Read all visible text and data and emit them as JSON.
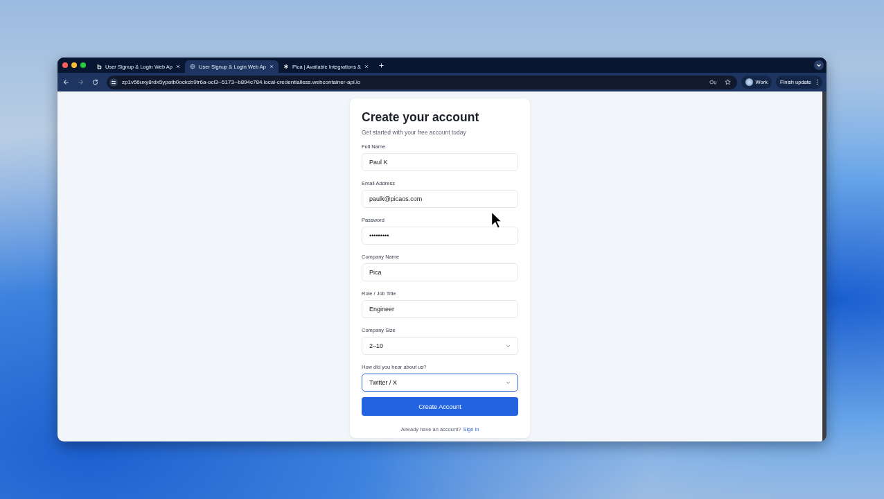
{
  "browser": {
    "tabs": [
      {
        "kind": "letter-logo",
        "title": "User Signup & Login Web Ap",
        "selected": false
      },
      {
        "kind": "globe",
        "title": "User Signup & Login Web Ap",
        "selected": true
      },
      {
        "kind": "asterisk",
        "title": "Pica | Available Integrations &",
        "selected": false
      }
    ],
    "url": "zp1v56uxy8rdx5ypatb0ockcb9tr6a-oci3--5173--b894c784.local-credentialless.webcontainer-api.io",
    "profile": "Work",
    "update_button": "Finish update"
  },
  "form": {
    "title": "Create your account",
    "subtitle": "Get started with your free account today",
    "fields": [
      {
        "kind": "text",
        "label": "Full Name",
        "value": "Paul K",
        "focused": false
      },
      {
        "kind": "text",
        "label": "Email Address",
        "value": "paulk@picaos.com",
        "focused": false
      },
      {
        "kind": "password",
        "label": "Password",
        "value": "•••••••••",
        "focused": false
      },
      {
        "kind": "text",
        "label": "Company Name",
        "value": "Pica",
        "focused": false
      },
      {
        "kind": "text",
        "label": "Role / Job Title",
        "value": "Engineer",
        "focused": false
      },
      {
        "kind": "select",
        "label": "Company Size",
        "value": "2–10",
        "focused": false
      },
      {
        "kind": "select",
        "label": "How did you hear about us?",
        "value": "Twitter / X",
        "focused": true
      }
    ],
    "submit": "Create Account",
    "footer_text": "Already have an account?",
    "footer_link": "Sign in"
  }
}
